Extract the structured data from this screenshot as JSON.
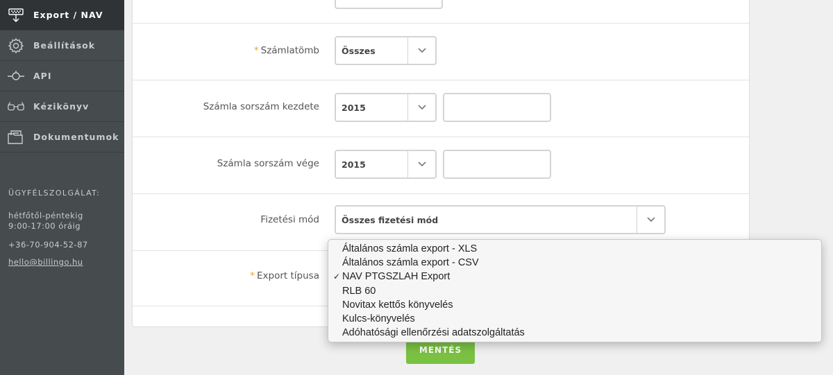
{
  "sidebar": {
    "items": [
      {
        "label": "Export / NAV",
        "icon": "export-icon",
        "active": true
      },
      {
        "label": "Beállítások",
        "icon": "gear-icon",
        "active": false
      },
      {
        "label": "API",
        "icon": "api-icon",
        "active": false
      },
      {
        "label": "Kézikönyv",
        "icon": "glasses-icon",
        "active": false
      },
      {
        "label": "Dokumentumok",
        "icon": "folder-icon",
        "active": false
      }
    ],
    "support": {
      "title": "ÜGYFÉLSZOLGÁLAT:",
      "hours_line1": "hétfőtől-péntekig",
      "hours_line2": "9:00-17:00 óráig",
      "phone": "+36-70-904-52-87",
      "email": "hello@billingo.hu"
    }
  },
  "form": {
    "szamlatomb": {
      "label": "Számlatömb",
      "required": true,
      "value": "Összes"
    },
    "sorszam_kezdete": {
      "label": "Számla sorszám kezdete",
      "year": "2015",
      "number": ""
    },
    "sorszam_vege": {
      "label": "Számla sorszám vége",
      "year": "2015",
      "number": ""
    },
    "fizetesi_mod": {
      "label": "Fizetési mód",
      "value": "Összes fizetési mód"
    },
    "export_tipusa": {
      "label": "Export típusa",
      "required": true
    }
  },
  "dropdown": {
    "selected_index": 2,
    "check_mark": "✓",
    "options": [
      "Általános számla export - XLS",
      "Általános számla export - CSV",
      "NAV PTGSZLAH Export",
      "RLB 60",
      "Novitax kettős könyvelés",
      "Kulcs-könyvelés",
      "Adóhatósági ellenőrzési adatszolgáltatás"
    ]
  },
  "actions": {
    "save_label": "MENTÉS"
  },
  "colors": {
    "sidebar": "#464b4d",
    "sidebar_active": "#2f3335",
    "accent_green": "#7ac143",
    "required_star": "#f0a030"
  }
}
